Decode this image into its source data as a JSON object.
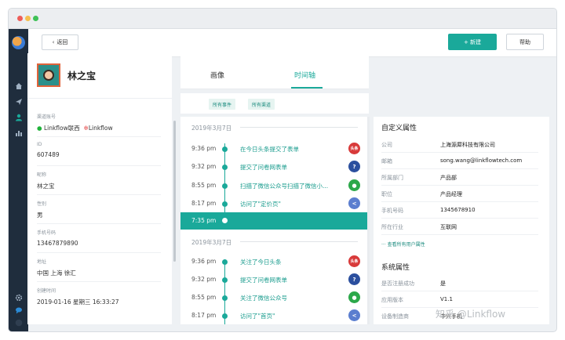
{
  "toolbar": {
    "back_label": "返回",
    "new_label": "+ 新建",
    "help_label": "帮助"
  },
  "profile": {
    "name": "林之宝",
    "fields": [
      {
        "label": "渠道账号",
        "value_wechat": "Linkflow联西",
        "value_weibo": "Linkflow"
      },
      {
        "label": "ID",
        "value": "607489"
      },
      {
        "label": "昵称",
        "value": "林之宝"
      },
      {
        "label": "性别",
        "value": "男"
      },
      {
        "label": "手机号码",
        "value": "13467879890"
      },
      {
        "label": "地址",
        "value": "中国 上海 徐汇"
      },
      {
        "label": "创建时间",
        "value": "2019-01-16 星期三 16:33:27"
      }
    ]
  },
  "tabs": [
    {
      "label": "画像"
    },
    {
      "label": "时间轴"
    }
  ],
  "filters": {
    "events": "所有事件",
    "channels": "所有渠道"
  },
  "timeline": {
    "groups": [
      {
        "date": "2019年3月7日",
        "events": [
          {
            "time": "9:36 pm",
            "text": "在今日头条提交了表单",
            "icon": "toutiao-icon",
            "icon_text": "头条"
          },
          {
            "time": "9:32 pm",
            "text": "提交了问卷网表单",
            "icon": "form-icon",
            "icon_text": "?"
          },
          {
            "time": "8:55 pm",
            "text": "扫描了微信公众号扫描了微信小...",
            "icon": "wechat-icon",
            "icon_text": "●"
          },
          {
            "time": "8:17 pm",
            "text": "访问了\"定价页\"",
            "icon": "share-icon",
            "icon_text": "<"
          }
        ]
      },
      {
        "date": "2019年3月7日",
        "events": [
          {
            "time": "9:36 pm",
            "text": "关注了今日头条",
            "icon": "toutiao-icon",
            "icon_text": "头条"
          },
          {
            "time": "9:32 pm",
            "text": "提交了问卷网表单",
            "icon": "form-icon",
            "icon_text": "?"
          },
          {
            "time": "8:55 pm",
            "text": "关注了微信公众号",
            "icon": "wechat-icon",
            "icon_text": "●"
          },
          {
            "time": "8:17 pm",
            "text": "访问了\"首页\"",
            "icon": "share-icon",
            "icon_text": "<"
          }
        ]
      }
    ],
    "current_time": "7:35 pm"
  },
  "custom_attributes": {
    "title": "自定义属性",
    "items": [
      {
        "key": "公司",
        "value": "上海源犀科技有限公司"
      },
      {
        "key": "邮箱",
        "value": "song.wang@linkflowtech.com"
      },
      {
        "key": "所属部门",
        "value": "产品部"
      },
      {
        "key": "职位",
        "value": "产品经理"
      },
      {
        "key": "手机号码",
        "value": "1345678910"
      },
      {
        "key": "所在行业",
        "value": "互联网"
      }
    ],
    "more_link": "··· 查看所有用户属性"
  },
  "system_attributes": {
    "title": "系统属性",
    "items": [
      {
        "key": "是否注册成功",
        "value": "是"
      },
      {
        "key": "应用版本",
        "value": "V1.1"
      },
      {
        "key": "设备制造商",
        "value": "中兴手机"
      }
    ]
  },
  "watermark": "知乎 @Linkflow",
  "colors": {
    "accent": "#1aa99a",
    "sidebar": "#1f2d3d"
  }
}
